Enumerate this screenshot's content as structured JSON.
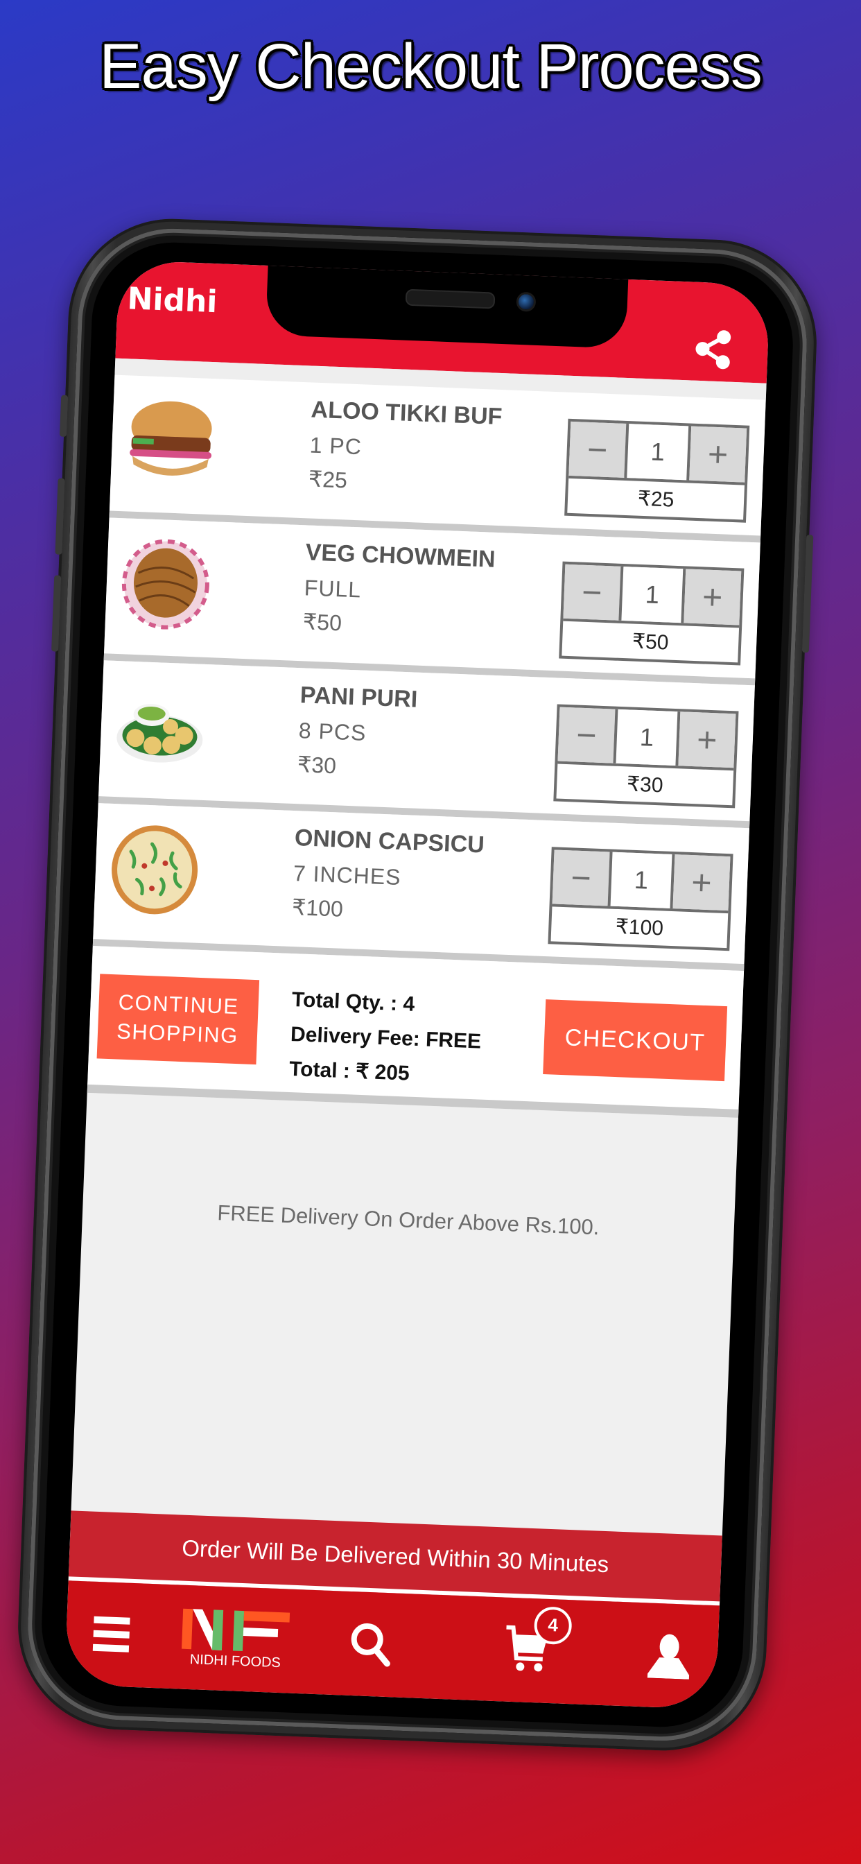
{
  "headline": "Easy Checkout Process",
  "app": {
    "title": "Nidhi",
    "share_icon": "share-icon",
    "brand_color": "#e8142f"
  },
  "cart": {
    "items": [
      {
        "name": "ALOO TIKKI BURGER",
        "name_visible": "ALOO TIKKI BUF",
        "variant": "1 PC",
        "price": "₹25",
        "qty": "1",
        "subtotal": "₹25",
        "image": "burger"
      },
      {
        "name": "VEG CHOWMEIN",
        "name_visible": "VEG CHOWMEIN",
        "variant": "FULL",
        "price": "₹50",
        "qty": "1",
        "subtotal": "₹50",
        "image": "noodles"
      },
      {
        "name": "PANI PURI",
        "name_visible": "PANI PURI",
        "variant": "8 PCS",
        "price": "₹30",
        "qty": "1",
        "subtotal": "₹30",
        "image": "pani-puri"
      },
      {
        "name": "ONION CAPSICUM PIZZA",
        "name_visible": "ONION CAPSICU",
        "variant": "7 INCHES",
        "price": "₹100",
        "qty": "1",
        "subtotal": "₹100",
        "image": "pizza"
      }
    ],
    "minus_label": "−",
    "plus_label": "+"
  },
  "summary": {
    "continue_label_line1": "CONTINUE",
    "continue_label_line2": "SHOPPING",
    "total_qty": "Total Qty. : 4",
    "delivery_fee": "Delivery Fee: FREE",
    "total": "Total : ₹ 205",
    "checkout_label": "CHECKOUT",
    "button_color": "#fd5f44"
  },
  "free_delivery_note": "FREE Delivery On Order Above Rs.100.",
  "delivery_banner": "Order Will Be Delivered Within 30 Minutes",
  "bottom_nav": {
    "menu_icon": "menu-icon",
    "logo_text": "NIDHI FOODS",
    "logo_letters": "NF",
    "search_icon": "search-icon",
    "cart_icon": "cart-icon",
    "cart_count": "4",
    "profile_icon": "user-icon"
  }
}
